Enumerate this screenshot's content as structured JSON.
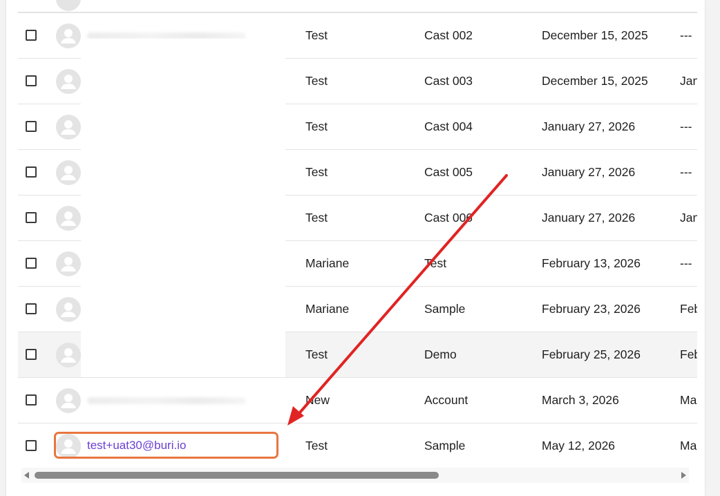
{
  "table": {
    "rows": [
      {
        "email": "",
        "first": "Test",
        "last": "Cast 002",
        "date": "December 15, 2025",
        "extra": "---"
      },
      {
        "email": "",
        "first": "Test",
        "last": "Cast 003",
        "date": "December 15, 2025",
        "extra": "Jan"
      },
      {
        "email": "",
        "first": "Test",
        "last": "Cast 004",
        "date": "January 27, 2026",
        "extra": "---"
      },
      {
        "email": "",
        "first": "Test",
        "last": "Cast 005",
        "date": "January 27, 2026",
        "extra": "---"
      },
      {
        "email": "",
        "first": "Test",
        "last": "Cast 006",
        "date": "January 27, 2026",
        "extra": "Jan"
      },
      {
        "email": "",
        "first": "Mariane",
        "last": "Test",
        "date": "February 13, 2026",
        "extra": "---"
      },
      {
        "email": "",
        "first": "Mariane",
        "last": "Sample",
        "date": "February 23, 2026",
        "extra": "Feb"
      },
      {
        "email": "",
        "first": "Test",
        "last": "Demo",
        "date": "February 25, 2026",
        "extra": "Feb"
      },
      {
        "email": "",
        "first": "New",
        "last": "Account",
        "date": "March 3, 2026",
        "extra": "Ma"
      },
      {
        "email": "test+uat30@buri.io",
        "first": "Test",
        "last": "Sample",
        "date": "May 12, 2026",
        "extra": "Ma"
      }
    ]
  },
  "colors": {
    "email_link": "#6b3fd4",
    "highlight": "#e8763f",
    "annotation_arrow": "#e02424",
    "hover_row": "#f4f4f4"
  }
}
